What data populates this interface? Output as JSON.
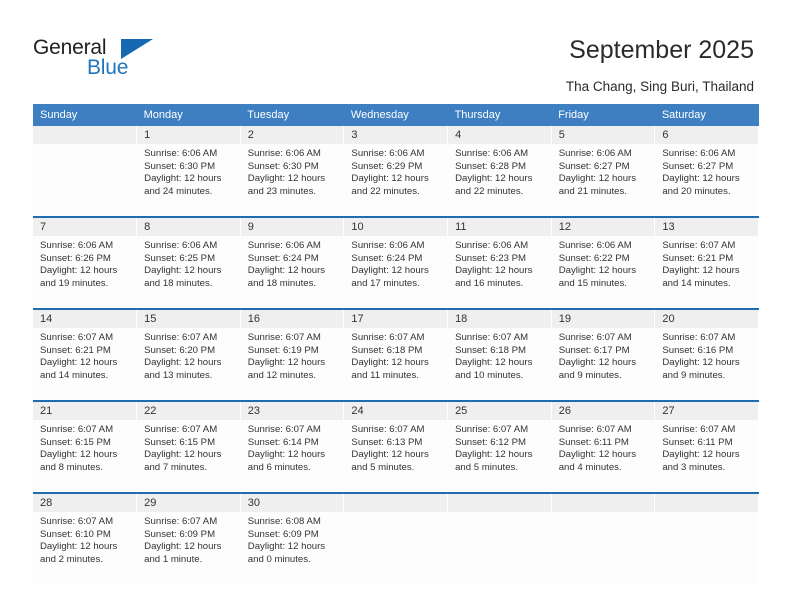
{
  "brand": {
    "line1": "General",
    "line2": "Blue",
    "flag_icon": "triangle-flag-icon",
    "color_general": "#231f20",
    "color_blue": "#1f76bd"
  },
  "header": {
    "title": "September 2025",
    "subtitle": "Tha Chang, Sing Buri, Thailand"
  },
  "colors": {
    "header_blue": "#3d7fc1",
    "separator_blue": "#1f6cb0",
    "daynum_band": "#efefef",
    "cell_background": "#fdfdfd",
    "text": "#333333"
  },
  "weekdays": [
    "Sunday",
    "Monday",
    "Tuesday",
    "Wednesday",
    "Thursday",
    "Friday",
    "Saturday"
  ],
  "weeks": [
    [
      {
        "day": "",
        "sunrise": "",
        "sunset": "",
        "daylight1": "",
        "daylight2": ""
      },
      {
        "day": "1",
        "sunrise": "Sunrise: 6:06 AM",
        "sunset": "Sunset: 6:30 PM",
        "daylight1": "Daylight: 12 hours",
        "daylight2": "and 24 minutes."
      },
      {
        "day": "2",
        "sunrise": "Sunrise: 6:06 AM",
        "sunset": "Sunset: 6:30 PM",
        "daylight1": "Daylight: 12 hours",
        "daylight2": "and 23 minutes."
      },
      {
        "day": "3",
        "sunrise": "Sunrise: 6:06 AM",
        "sunset": "Sunset: 6:29 PM",
        "daylight1": "Daylight: 12 hours",
        "daylight2": "and 22 minutes."
      },
      {
        "day": "4",
        "sunrise": "Sunrise: 6:06 AM",
        "sunset": "Sunset: 6:28 PM",
        "daylight1": "Daylight: 12 hours",
        "daylight2": "and 22 minutes."
      },
      {
        "day": "5",
        "sunrise": "Sunrise: 6:06 AM",
        "sunset": "Sunset: 6:27 PM",
        "daylight1": "Daylight: 12 hours",
        "daylight2": "and 21 minutes."
      },
      {
        "day": "6",
        "sunrise": "Sunrise: 6:06 AM",
        "sunset": "Sunset: 6:27 PM",
        "daylight1": "Daylight: 12 hours",
        "daylight2": "and 20 minutes."
      }
    ],
    [
      {
        "day": "7",
        "sunrise": "Sunrise: 6:06 AM",
        "sunset": "Sunset: 6:26 PM",
        "daylight1": "Daylight: 12 hours",
        "daylight2": "and 19 minutes."
      },
      {
        "day": "8",
        "sunrise": "Sunrise: 6:06 AM",
        "sunset": "Sunset: 6:25 PM",
        "daylight1": "Daylight: 12 hours",
        "daylight2": "and 18 minutes."
      },
      {
        "day": "9",
        "sunrise": "Sunrise: 6:06 AM",
        "sunset": "Sunset: 6:24 PM",
        "daylight1": "Daylight: 12 hours",
        "daylight2": "and 18 minutes."
      },
      {
        "day": "10",
        "sunrise": "Sunrise: 6:06 AM",
        "sunset": "Sunset: 6:24 PM",
        "daylight1": "Daylight: 12 hours",
        "daylight2": "and 17 minutes."
      },
      {
        "day": "11",
        "sunrise": "Sunrise: 6:06 AM",
        "sunset": "Sunset: 6:23 PM",
        "daylight1": "Daylight: 12 hours",
        "daylight2": "and 16 minutes."
      },
      {
        "day": "12",
        "sunrise": "Sunrise: 6:06 AM",
        "sunset": "Sunset: 6:22 PM",
        "daylight1": "Daylight: 12 hours",
        "daylight2": "and 15 minutes."
      },
      {
        "day": "13",
        "sunrise": "Sunrise: 6:07 AM",
        "sunset": "Sunset: 6:21 PM",
        "daylight1": "Daylight: 12 hours",
        "daylight2": "and 14 minutes."
      }
    ],
    [
      {
        "day": "14",
        "sunrise": "Sunrise: 6:07 AM",
        "sunset": "Sunset: 6:21 PM",
        "daylight1": "Daylight: 12 hours",
        "daylight2": "and 14 minutes."
      },
      {
        "day": "15",
        "sunrise": "Sunrise: 6:07 AM",
        "sunset": "Sunset: 6:20 PM",
        "daylight1": "Daylight: 12 hours",
        "daylight2": "and 13 minutes."
      },
      {
        "day": "16",
        "sunrise": "Sunrise: 6:07 AM",
        "sunset": "Sunset: 6:19 PM",
        "daylight1": "Daylight: 12 hours",
        "daylight2": "and 12 minutes."
      },
      {
        "day": "17",
        "sunrise": "Sunrise: 6:07 AM",
        "sunset": "Sunset: 6:18 PM",
        "daylight1": "Daylight: 12 hours",
        "daylight2": "and 11 minutes."
      },
      {
        "day": "18",
        "sunrise": "Sunrise: 6:07 AM",
        "sunset": "Sunset: 6:18 PM",
        "daylight1": "Daylight: 12 hours",
        "daylight2": "and 10 minutes."
      },
      {
        "day": "19",
        "sunrise": "Sunrise: 6:07 AM",
        "sunset": "Sunset: 6:17 PM",
        "daylight1": "Daylight: 12 hours",
        "daylight2": "and 9 minutes."
      },
      {
        "day": "20",
        "sunrise": "Sunrise: 6:07 AM",
        "sunset": "Sunset: 6:16 PM",
        "daylight1": "Daylight: 12 hours",
        "daylight2": "and 9 minutes."
      }
    ],
    [
      {
        "day": "21",
        "sunrise": "Sunrise: 6:07 AM",
        "sunset": "Sunset: 6:15 PM",
        "daylight1": "Daylight: 12 hours",
        "daylight2": "and 8 minutes."
      },
      {
        "day": "22",
        "sunrise": "Sunrise: 6:07 AM",
        "sunset": "Sunset: 6:15 PM",
        "daylight1": "Daylight: 12 hours",
        "daylight2": "and 7 minutes."
      },
      {
        "day": "23",
        "sunrise": "Sunrise: 6:07 AM",
        "sunset": "Sunset: 6:14 PM",
        "daylight1": "Daylight: 12 hours",
        "daylight2": "and 6 minutes."
      },
      {
        "day": "24",
        "sunrise": "Sunrise: 6:07 AM",
        "sunset": "Sunset: 6:13 PM",
        "daylight1": "Daylight: 12 hours",
        "daylight2": "and 5 minutes."
      },
      {
        "day": "25",
        "sunrise": "Sunrise: 6:07 AM",
        "sunset": "Sunset: 6:12 PM",
        "daylight1": "Daylight: 12 hours",
        "daylight2": "and 5 minutes."
      },
      {
        "day": "26",
        "sunrise": "Sunrise: 6:07 AM",
        "sunset": "Sunset: 6:11 PM",
        "daylight1": "Daylight: 12 hours",
        "daylight2": "and 4 minutes."
      },
      {
        "day": "27",
        "sunrise": "Sunrise: 6:07 AM",
        "sunset": "Sunset: 6:11 PM",
        "daylight1": "Daylight: 12 hours",
        "daylight2": "and 3 minutes."
      }
    ],
    [
      {
        "day": "28",
        "sunrise": "Sunrise: 6:07 AM",
        "sunset": "Sunset: 6:10 PM",
        "daylight1": "Daylight: 12 hours",
        "daylight2": "and 2 minutes."
      },
      {
        "day": "29",
        "sunrise": "Sunrise: 6:07 AM",
        "sunset": "Sunset: 6:09 PM",
        "daylight1": "Daylight: 12 hours",
        "daylight2": "and 1 minute."
      },
      {
        "day": "30",
        "sunrise": "Sunrise: 6:08 AM",
        "sunset": "Sunset: 6:09 PM",
        "daylight1": "Daylight: 12 hours",
        "daylight2": "and 0 minutes."
      },
      {
        "day": "",
        "sunrise": "",
        "sunset": "",
        "daylight1": "",
        "daylight2": ""
      },
      {
        "day": "",
        "sunrise": "",
        "sunset": "",
        "daylight1": "",
        "daylight2": ""
      },
      {
        "day": "",
        "sunrise": "",
        "sunset": "",
        "daylight1": "",
        "daylight2": ""
      },
      {
        "day": "",
        "sunrise": "",
        "sunset": "",
        "daylight1": "",
        "daylight2": ""
      }
    ]
  ]
}
